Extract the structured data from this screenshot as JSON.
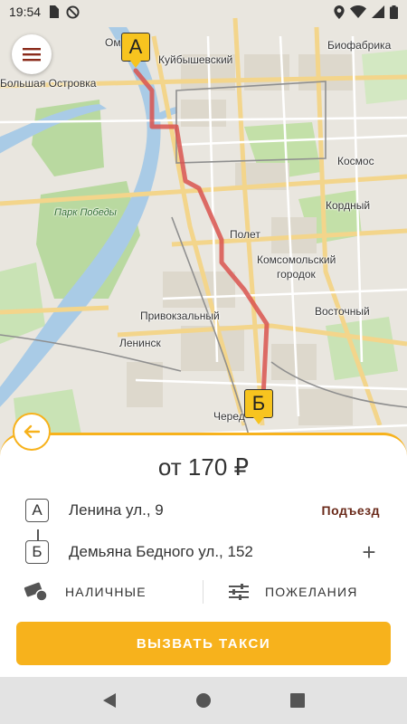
{
  "status_bar": {
    "time": "19:54",
    "icons_left": [
      "sim-card-icon",
      "no-disturb-icon"
    ],
    "icons_right": [
      "location-icon",
      "wifi-icon",
      "signal-icon",
      "battery-icon"
    ]
  },
  "map": {
    "labels": [
      {
        "id": "omsk",
        "text": "Ом"
      },
      {
        "id": "kuibyshevsky",
        "text": "Куйбышевский"
      },
      {
        "id": "biofabrika",
        "text": "Биофабрика"
      },
      {
        "id": "bolshaya_ostrovka",
        "text": "Большая Островка"
      },
      {
        "id": "kosmos",
        "text": "Космос"
      },
      {
        "id": "kordny",
        "text": "Кордный"
      },
      {
        "id": "park_pobedy",
        "text": "Парк Победы"
      },
      {
        "id": "polet",
        "text": "Полет"
      },
      {
        "id": "komsomolsky",
        "text": "Комсомольский"
      },
      {
        "id": "gorodok",
        "text": "городок"
      },
      {
        "id": "privokzalny",
        "text": "Привокзальный"
      },
      {
        "id": "vostochny",
        "text": "Восточный"
      },
      {
        "id": "leninsk",
        "text": "Ленинск"
      },
      {
        "id": "chered",
        "text": "Черед"
      }
    ],
    "route_color": "#d9534f",
    "marker_a": "A",
    "marker_b": "Б"
  },
  "sheet": {
    "price": "от 170 ₽",
    "point_a": {
      "badge": "A",
      "address": "Ленина ул., 9",
      "action": "Подъезд"
    },
    "point_b": {
      "badge": "Б",
      "address": "Демьяна Бедного ул., 152",
      "action": "+"
    },
    "payment_label": "НАЛИЧНЫЕ",
    "wishes_label": "ПОЖЕЛАНИЯ",
    "call_button": "ВЫЗВАТЬ ТАКСИ"
  },
  "colors": {
    "accent": "#f7b21c",
    "marker": "#f7c41f",
    "route": "#d9534f"
  },
  "nav_bar": {
    "icons": [
      "back-triangle-icon",
      "home-circle-icon",
      "recents-square-icon"
    ]
  }
}
